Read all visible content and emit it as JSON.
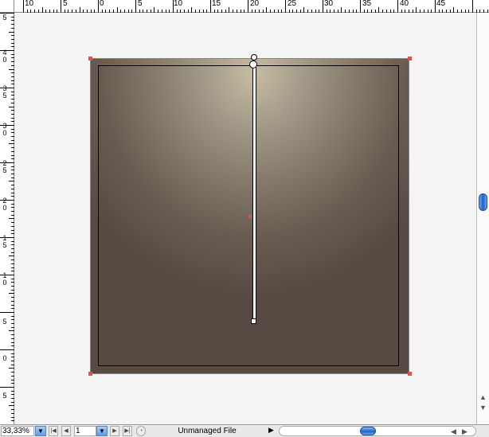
{
  "ruler": {
    "top_labels": [
      "10",
      "5",
      "0",
      "5",
      "10",
      "15",
      "20",
      "25",
      "30",
      "35",
      "40",
      "45"
    ],
    "left_labels": [
      "5",
      "4\n0",
      "3\n5",
      "3\n0",
      "2\n5",
      "2\n0",
      "1\n5",
      "1\n0",
      "5",
      "0",
      "5"
    ]
  },
  "statusbar": {
    "zoom": "33,33%",
    "page": "1",
    "file_status": "Unmanaged File"
  },
  "colors": {
    "selection": "#e05050",
    "scroll_thumb": "#1c62c8"
  }
}
